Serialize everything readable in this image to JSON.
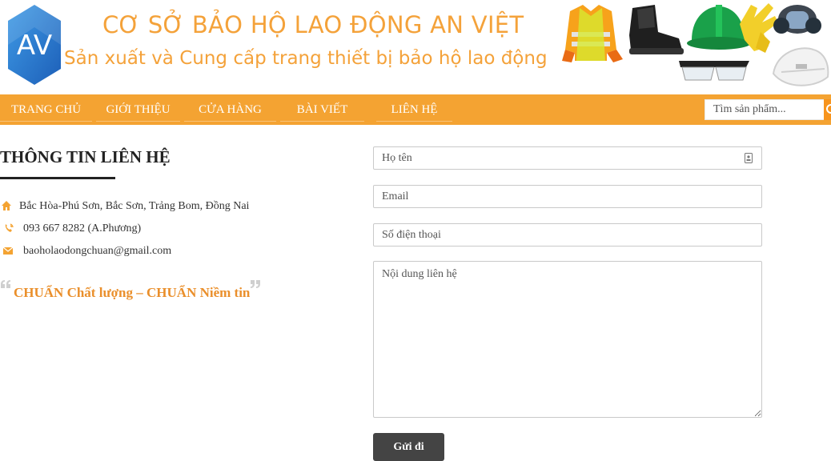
{
  "brand": {
    "logo_text": "AV",
    "title": "CƠ SỞ BẢO HỘ LAO ĐỘNG AN VIỆT",
    "subtitle": "Sản xuất và Cung cấp trang thiết bị bảo hộ lao động"
  },
  "nav": {
    "items": [
      {
        "label": "TRANG CHỦ"
      },
      {
        "label": "GIỚI THIỆU"
      },
      {
        "label": "CỬA HÀNG"
      },
      {
        "label": "BÀI VIẾT"
      },
      {
        "label": "LIÊN HỆ"
      }
    ],
    "search_placeholder": "Tìm sản phẩm..."
  },
  "contact": {
    "title": "THÔNG TIN LIÊN HỆ",
    "address": "Bắc Hòa-Phú Sơn, Bắc Sơn, Trảng Bom, Đồng Nai",
    "phone": "093 667 8282 (A.Phương)",
    "email": "baoholaodongchuan@gmail.com",
    "slogan": "CHUẨN Chất lượng – CHUẨN Niềm tin"
  },
  "form": {
    "name_placeholder": "Họ tên",
    "email_placeholder": "Email",
    "phone_placeholder": "Số điện thoại",
    "message_placeholder": "Nội dung liên hệ",
    "submit_label": "Gửi đi"
  },
  "colors": {
    "accent": "#f4a332",
    "brand_text": "#f4a23a",
    "logo_blue": "#2a7fd4",
    "slogan": "#ea8f2b",
    "button": "#444444"
  }
}
